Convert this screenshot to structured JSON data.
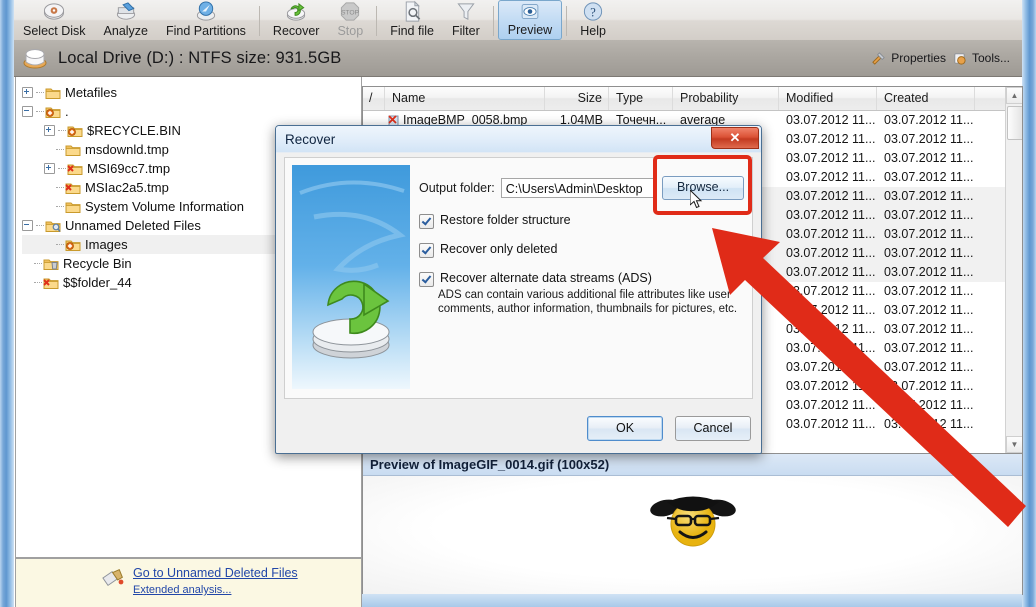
{
  "toolbar": {
    "buttons": [
      {
        "label": "Select Disk",
        "icon": "select-disk-icon",
        "state": "normal"
      },
      {
        "label": "Analyze",
        "icon": "analyze-icon",
        "state": "normal"
      },
      {
        "label": "Find Partitions",
        "icon": "find-partitions-icon",
        "state": "normal"
      },
      {
        "label": "Recover",
        "icon": "recover-icon",
        "state": "normal"
      },
      {
        "label": "Stop",
        "icon": "stop-icon",
        "state": "disabled"
      },
      {
        "label": "Find file",
        "icon": "find-file-icon",
        "state": "normal"
      },
      {
        "label": "Filter",
        "icon": "filter-icon",
        "state": "normal"
      },
      {
        "label": "Preview",
        "icon": "preview-icon",
        "state": "active"
      },
      {
        "label": "Help",
        "icon": "help-icon",
        "state": "normal"
      }
    ]
  },
  "drive_bar": {
    "title": "Local Drive (D:) : NTFS size: 931.5GB",
    "properties_label": "Properties",
    "tools_label": "Tools..."
  },
  "tree": {
    "items": [
      {
        "label": "Metafiles",
        "depth": 0,
        "toggle": "plus",
        "icon": "folder-icon"
      },
      {
        "label": ".",
        "depth": 0,
        "toggle": "minus",
        "icon": "folder-deleted-icon"
      },
      {
        "label": "$RECYCLE.BIN",
        "depth": 1,
        "toggle": "plus",
        "icon": "folder-deleted-icon"
      },
      {
        "label": "msdownld.tmp",
        "depth": 1,
        "toggle": "none",
        "icon": "folder-icon"
      },
      {
        "label": "MSI69cc7.tmp",
        "depth": 1,
        "toggle": "plus",
        "icon": "folder-red-icon"
      },
      {
        "label": "MSIac2a5.tmp",
        "depth": 1,
        "toggle": "none",
        "icon": "folder-red-icon"
      },
      {
        "label": "System Volume Information",
        "depth": 1,
        "toggle": "none",
        "icon": "folder-icon"
      },
      {
        "label": "Unnamed Deleted Files",
        "depth": 0,
        "toggle": "minus",
        "icon": "folder-search-icon"
      },
      {
        "label": "Images",
        "depth": 1,
        "toggle": "none",
        "icon": "folder-deleted-icon",
        "selected": true
      },
      {
        "label": "Recycle Bin",
        "depth": 0,
        "toggle": "none",
        "icon": "recycle-bin-icon"
      },
      {
        "label": "$$folder_44",
        "depth": 0,
        "toggle": "none",
        "icon": "folder-red-icon"
      }
    ]
  },
  "file_list": {
    "columns": [
      "/",
      "Name",
      "Size",
      "Type",
      "Probability",
      "Modified",
      "Created"
    ],
    "rows": [
      {
        "num": "",
        "name": "ImageBMP_0058.bmp",
        "size": "1.04MB",
        "type": "Точечн...",
        "probability": "average",
        "modified": "03.07.2012 11...",
        "created": "03.07.2012 11..."
      },
      {
        "num": "",
        "name": "",
        "size": "",
        "type": "",
        "probability": "",
        "modified": "03.07.2012 11...",
        "created": "03.07.2012 11..."
      },
      {
        "num": "",
        "name": "",
        "size": "",
        "type": "",
        "probability": "",
        "modified": "03.07.2012 11...",
        "created": "03.07.2012 11..."
      },
      {
        "num": "",
        "name": "",
        "size": "",
        "type": "",
        "probability": "",
        "modified": "03.07.2012 11...",
        "created": "03.07.2012 11..."
      },
      {
        "num": "",
        "name": "",
        "size": "",
        "type": "",
        "probability": "",
        "modified": "03.07.2012 11...",
        "created": "03.07.2012 11..."
      },
      {
        "num": "",
        "name": "",
        "size": "",
        "type": "",
        "probability": "",
        "modified": "03.07.2012 11...",
        "created": "03.07.2012 11..."
      },
      {
        "num": "",
        "name": "",
        "size": "",
        "type": "",
        "probability": "",
        "modified": "03.07.2012 11...",
        "created": "03.07.2012 11..."
      },
      {
        "num": "",
        "name": "",
        "size": "",
        "type": "",
        "probability": "",
        "modified": "03.07.2012 11...",
        "created": "03.07.2012 11..."
      },
      {
        "num": "",
        "name": "",
        "size": "",
        "type": "",
        "probability": "",
        "modified": "03.07.2012 11...",
        "created": "03.07.2012 11..."
      },
      {
        "num": "",
        "name": "",
        "size": "",
        "type": "",
        "probability": "",
        "modified": "03.07.2012 11...",
        "created": "03.07.2012 11..."
      },
      {
        "num": "",
        "name": "",
        "size": "",
        "type": "",
        "probability": "",
        "modified": "03.07.2012 11...",
        "created": "03.07.2012 11..."
      },
      {
        "num": "",
        "name": "",
        "size": "",
        "type": "",
        "probability": "",
        "modified": "03.07.2012 11...",
        "created": "03.07.2012 11..."
      },
      {
        "num": "",
        "name": "",
        "size": "",
        "type": "",
        "probability": "",
        "modified": "03.07.2012 11...",
        "created": "03.07.2012 11..."
      },
      {
        "num": "",
        "name": "",
        "size": "",
        "type": "",
        "probability": "",
        "modified": "03.07.2012 11...",
        "created": "03.07.2012 11..."
      },
      {
        "num": "",
        "name": "",
        "size": "",
        "type": "",
        "probability": "",
        "modified": "03.07.2012 11...",
        "created": "03.07.2012 11..."
      },
      {
        "num": "",
        "name": "",
        "size": "",
        "type": "",
        "probability": "",
        "modified": "03.07.2012 11...",
        "created": "03.07.2012 11..."
      },
      {
        "num": "",
        "name": "",
        "size": "",
        "type": "",
        "probability": "",
        "modified": "03.07.2012 11...",
        "created": "03.07.2012 11..."
      }
    ]
  },
  "preview": {
    "title": "Preview of ImageGIF_0014.gif (100x52)"
  },
  "status": {
    "main_link": "Go to Unnamed Deleted Files",
    "sub_link": "Extended analysis..."
  },
  "dialog": {
    "title": "Recover",
    "close_label": "✕",
    "output_folder_label": "Output folder:",
    "output_folder_value": "C:\\Users\\Admin\\Desktop",
    "browse_label": "Browse...",
    "checkboxes": [
      {
        "label": "Restore folder structure",
        "checked": true
      },
      {
        "label": "Recover only deleted",
        "checked": true
      },
      {
        "label": "Recover alternate data streams (ADS)",
        "checked": true
      }
    ],
    "ads_description_line1": "ADS can contain various additional file attributes like user",
    "ads_description_line2": "comments, author information, thumbnails for pictures, etc.",
    "ok_label": "OK",
    "cancel_label": "Cancel"
  },
  "annotations": {
    "highlight_color": "#e02b18",
    "arrow_color": "#e02b18"
  }
}
